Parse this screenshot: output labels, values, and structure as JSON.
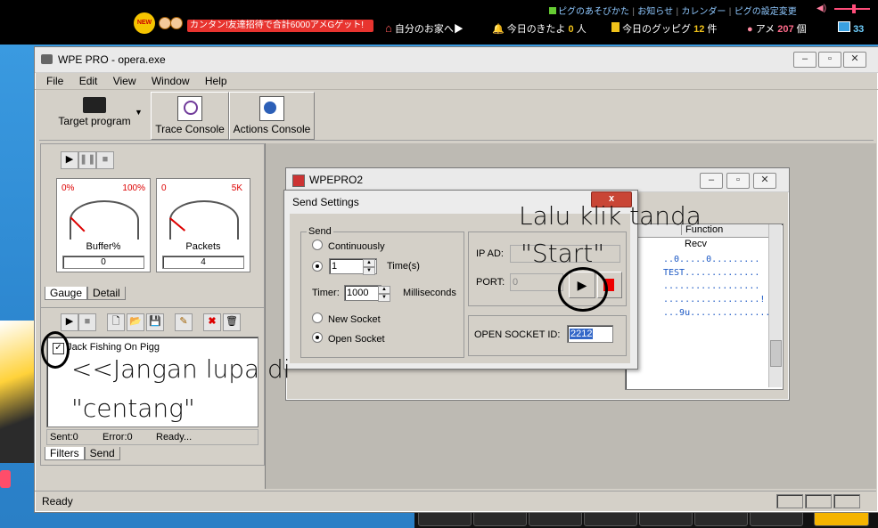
{
  "topbar": {
    "badge": "NEW",
    "promo": "カンタン!友達招待で合計6000アメGゲット!",
    "links": [
      "ピグのあそびかた",
      "お知らせ",
      "カレンダー",
      "ピグの設定変更"
    ],
    "home": "自分のお家へ▶",
    "visitors_label": "今日のきたよ",
    "visitors_count": "0",
    "visitors_unit": "人",
    "good_label": "今日のグッピグ",
    "good_count": "12",
    "good_unit": "件",
    "ame_label": "アメ",
    "ame_count": "207",
    "ame_unit": "個",
    "coins": "33"
  },
  "main_window": {
    "title": "WPE PRO - opera.exe",
    "menu": [
      "File",
      "Edit",
      "View",
      "Window",
      "Help"
    ],
    "toolbar": {
      "target_program": "Target program",
      "trace_console": "Trace Console",
      "actions_console": "Actions Console"
    },
    "gauges": [
      {
        "label": "Buffer%",
        "min": "0%",
        "max": "100%",
        "value": "0"
      },
      {
        "label": "Packets",
        "min": "0",
        "max": "5K",
        "value": "4"
      }
    ],
    "gauge_tabs": [
      "Gauge",
      "Detail"
    ],
    "filter_item": "Jack Fishing On Pigg",
    "filter_checked": true,
    "status_row": {
      "sent": "Sent:0",
      "error": "Error:0",
      "state": "Ready..."
    },
    "filter_tabs": [
      "Filters",
      "Send"
    ],
    "statusbar": "Ready"
  },
  "wpepro2": {
    "title": "WPEPRO2",
    "column": "Function",
    "rows": [
      "Recv",
      "..0.....0.........",
      "TEST..............",
      "..................",
      "..................!",
      "...9u..............."
    ]
  },
  "send_settings": {
    "title": "Send Settings",
    "close": "x",
    "group_send": "Send",
    "continuously": "Continuously",
    "times_value": "1",
    "times_label": "Time(s)",
    "timer_label": "Timer:",
    "timer_value": "1000",
    "timer_unit": "Milliseconds",
    "new_socket": "New Socket",
    "open_socket": "Open Socket",
    "selected_mode": "times",
    "selected_socket": "open",
    "ip_label": "IP AD:",
    "port_label": "PORT:",
    "port_value": "0",
    "socket_id_label": "OPEN SOCKET ID:",
    "socket_id_value": "2212"
  },
  "annotations": {
    "right_line1": "Lalu klik tanda",
    "right_line2": "\"Start\"",
    "left_line1": "<<Jangan lupa di",
    "left_line2": "\"centang\""
  }
}
